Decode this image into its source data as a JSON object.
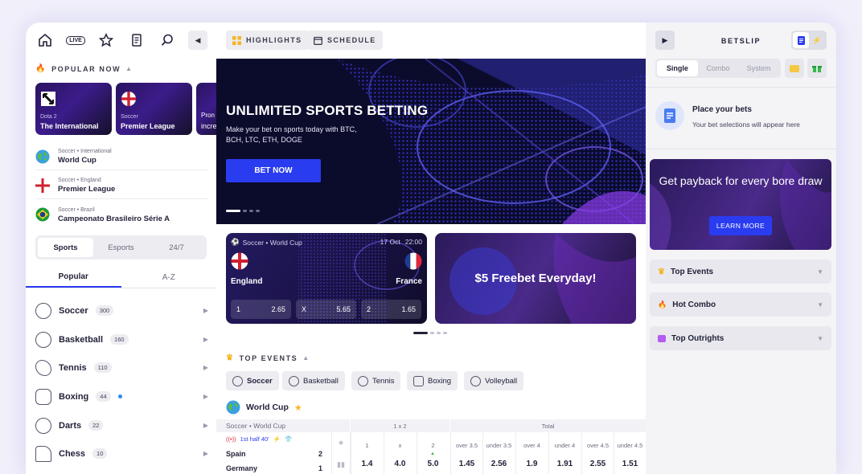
{
  "nav": {
    "live_badge": "LIVE",
    "collapse_icon": "chevron-left-icon"
  },
  "popular": {
    "title": "POPULAR NOW",
    "cards": [
      {
        "category": "Dota 2",
        "name": "The International"
      },
      {
        "category": "Soccer",
        "name": "Premier League"
      },
      {
        "category": "Pron",
        "name": "incre"
      }
    ],
    "leagues": [
      {
        "meta": "Soccer • International",
        "name": "World Cup"
      },
      {
        "meta": "Soccer • England",
        "name": "Premier League"
      },
      {
        "meta": "Soccer • Brazil",
        "name": "Campeonato Brasileiro Série A"
      }
    ]
  },
  "mode_tabs": [
    "Sports",
    "Esports",
    "24/7"
  ],
  "list_tabs": [
    "Popular",
    "A-Z"
  ],
  "sports": [
    {
      "name": "Soccer",
      "count": "300"
    },
    {
      "name": "Basketball",
      "count": "160"
    },
    {
      "name": "Tennis",
      "count": "110"
    },
    {
      "name": "Boxing",
      "count": "44"
    },
    {
      "name": "Darts",
      "count": "22"
    },
    {
      "name": "Chess",
      "count": "10"
    }
  ],
  "mid_tabs": {
    "highlights": "HIGHLIGHTS",
    "schedule": "SCHEDULE"
  },
  "hero": {
    "title": "UNLIMITED SPORTS BETTING",
    "subtitle": "Make your bet on sports today with BTC, BCH, LTC, ETH, DOGE",
    "button": "BET NOW"
  },
  "match": {
    "meta": "Soccer • World Cup",
    "date": "17 Oct",
    "time": "22:00",
    "home": "England",
    "away": "France",
    "odds": [
      {
        "label": "1",
        "value": "2.65"
      },
      {
        "label": "X",
        "value": "5.65"
      },
      {
        "label": "2",
        "value": "1.65"
      }
    ]
  },
  "promo": {
    "title": "$5 Freebet Everyday!"
  },
  "top_events": {
    "title": "TOP EVENTS",
    "chips": [
      "Soccer",
      "Basketball",
      "Tennis",
      "Boxing",
      "Volleyball"
    ]
  },
  "world_cup": {
    "title": "World Cup"
  },
  "table": {
    "league": "Soccer • World Cup",
    "group_1x2": "1 x 2",
    "group_total": "Total",
    "live": "1st half 40'",
    "team1": "Spain",
    "score1": "2",
    "team2": "Germany",
    "score2": "1",
    "cols": [
      "1",
      "x",
      "2",
      "over 3.5",
      "under 3.5",
      "over 4",
      "under 4",
      "over 4.5",
      "under 4.5"
    ],
    "vals": [
      "1.4",
      "4.0",
      "5.0",
      "1.45",
      "2.56",
      "1.9",
      "1.91",
      "2.55",
      "1.51"
    ]
  },
  "betslip": {
    "title": "BETSLIP",
    "tabs": [
      "Single",
      "Combo",
      "System"
    ],
    "place_title": "Place your bets",
    "place_sub": "Your bet selections will appear here",
    "payback_title": "Get payback for every bore draw",
    "payback_btn": "LEARN MORE",
    "sections": [
      "Top Events",
      "Hot Combo",
      "Top Outrights"
    ]
  }
}
